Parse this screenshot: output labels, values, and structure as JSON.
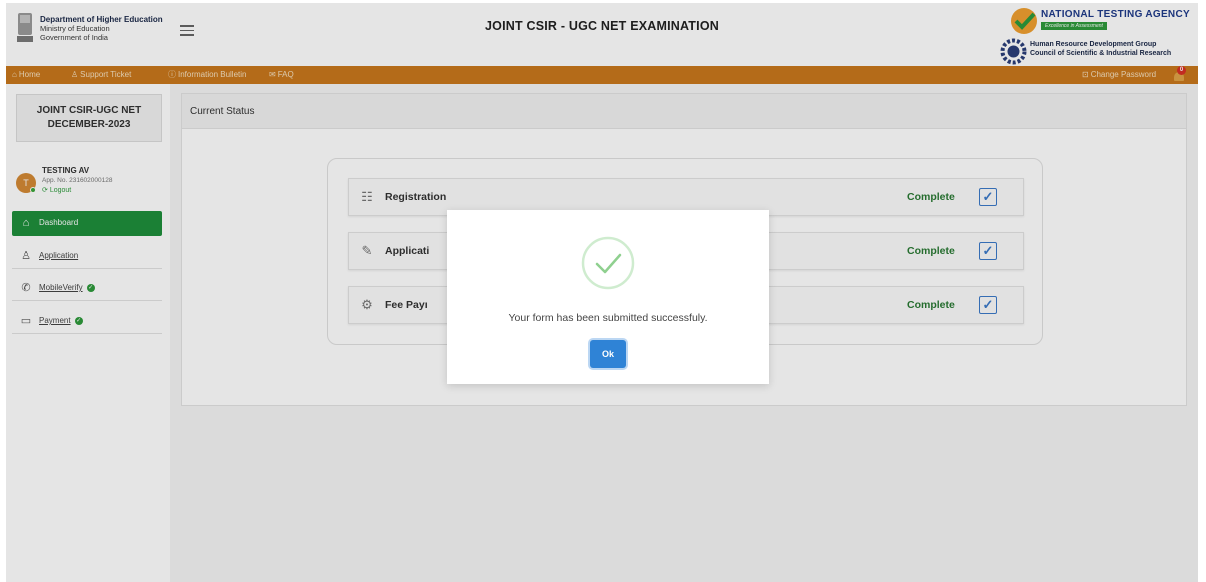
{
  "header": {
    "dept_line1": "Department of Higher Education",
    "dept_line2": "Ministry of Education",
    "dept_line3": "Government of India",
    "title": "JOINT CSIR - UGC NET EXAMINATION",
    "agency_name": "NATIONAL TESTING AGENCY",
    "agency_tagline": "Excellence in Assessment",
    "hrd_line1": "Human Resource Development Group",
    "hrd_line2": "Council of Scientific & Industrial Research"
  },
  "navbar": {
    "home": "Home",
    "support": "Support Ticket",
    "bulletin": "Information Bulletin",
    "faq": "FAQ",
    "change_password": "Change Password",
    "notification_count": "0"
  },
  "sidebar": {
    "exam_line1": "JOINT CSIR-UGC NET",
    "exam_line2": "DECEMBER-2023",
    "user": {
      "initial": "T",
      "name": "TESTING AV",
      "app_no": "App. No. 231602000128",
      "logout": "Logout"
    },
    "items": [
      {
        "label": "Dashboard",
        "icon": "home-icon"
      },
      {
        "label": "Application",
        "icon": "user-add-icon"
      },
      {
        "label": "MobileVerify",
        "icon": "phone-icon"
      },
      {
        "label": "Payment",
        "icon": "card-icon"
      }
    ]
  },
  "main": {
    "panel_title": "Current Status",
    "status_rows": [
      {
        "label": "Registration",
        "status": "Complete",
        "icon": "registration-icon"
      },
      {
        "label": "Applicati",
        "status": "Complete",
        "icon": "application-icon"
      },
      {
        "label": "Fee Payı",
        "status": "Complete",
        "icon": "fee-payment-icon"
      }
    ]
  },
  "modal": {
    "message": "Your form has been submitted successfuly.",
    "ok_label": "Ok"
  },
  "colors": {
    "navbar": "#c9781c",
    "active_sidebar": "#1f8f3c",
    "status_complete": "#2a7a34",
    "ok_button": "#2f83d6",
    "success_check": "#8fd08f"
  }
}
